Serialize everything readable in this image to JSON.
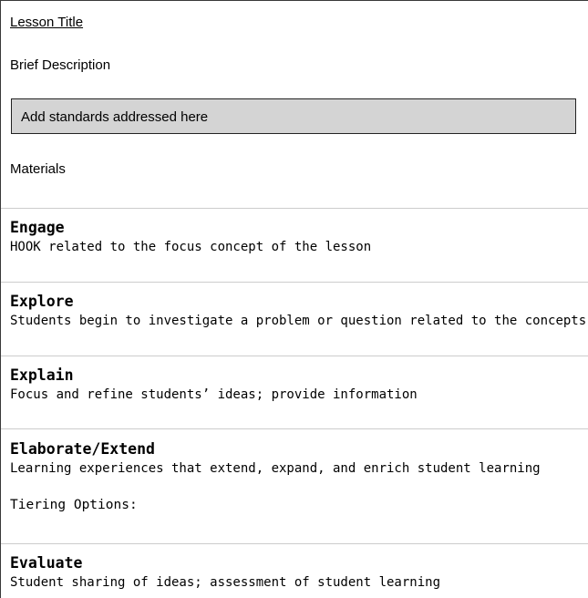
{
  "header": {
    "lesson_title": "Lesson Title",
    "brief_description": "Brief Description",
    "standards_placeholder": "Add standards addressed here",
    "materials": "Materials"
  },
  "sections": [
    {
      "title": "Engage",
      "description": "HOOK related to the focus concept of the lesson"
    },
    {
      "title": "Explore",
      "description": "Students begin to investigate a problem or question related to the concepts"
    },
    {
      "title": "Explain",
      "description": "Focus and refine students’ ideas; provide information"
    },
    {
      "title": "Elaborate/Extend",
      "description": "Learning experiences that extend, expand, and enrich student learning",
      "extra": "Tiering Options:"
    },
    {
      "title": "Evaluate",
      "description": "Student sharing of ideas; assessment of student learning"
    }
  ]
}
